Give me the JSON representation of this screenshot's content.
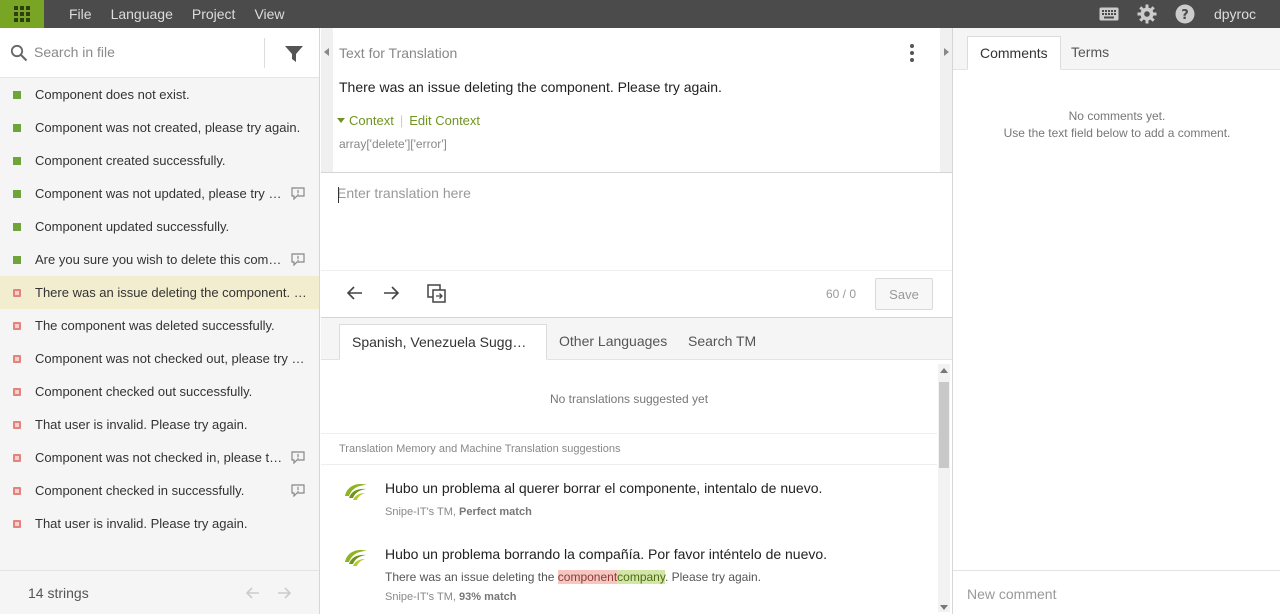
{
  "menu": [
    "File",
    "Language",
    "Project",
    "View"
  ],
  "user": {
    "name": "dpyroc"
  },
  "icons": {
    "apps": "apps-grid-icon",
    "keyboard": "keyboard-icon",
    "settings": "gear-icon",
    "help": "help-icon"
  },
  "colors": {
    "accent": "#78a524",
    "topbar": "#4b4b4b",
    "translated": "#6fa43a",
    "untranslated": "#e4837e",
    "selected_row": "#f3edcf",
    "link": "#6f9520"
  },
  "sidebar": {
    "search_placeholder": "Search in file",
    "strings": [
      {
        "text": "Component does not exist.",
        "status": "translated",
        "comment": false
      },
      {
        "text": "Component was not created, please try again.",
        "status": "translated",
        "comment": false
      },
      {
        "text": "Component created successfully.",
        "status": "translated",
        "comment": false
      },
      {
        "text": "Component was not updated, please try again.",
        "status": "translated",
        "comment": true
      },
      {
        "text": "Component updated successfully.",
        "status": "translated",
        "comment": false
      },
      {
        "text": "Are you sure you wish to delete this component?",
        "status": "translated",
        "comment": true
      },
      {
        "text": "There was an issue deleting the component. Please try again.",
        "status": "untranslated",
        "comment": false,
        "active": true
      },
      {
        "text": "The component was deleted successfully.",
        "status": "untranslated",
        "comment": false
      },
      {
        "text": "Component was not checked out, please try again.",
        "status": "untranslated",
        "comment": false
      },
      {
        "text": "Component checked out successfully.",
        "status": "untranslated",
        "comment": false
      },
      {
        "text": "That user is invalid. Please try again.",
        "status": "untranslated",
        "comment": false
      },
      {
        "text": "Component was not checked in, please try again.",
        "status": "untranslated",
        "comment": true
      },
      {
        "text": "Component checked in successfully.",
        "status": "untranslated",
        "comment": true
      },
      {
        "text": "That user is invalid. Please try again.",
        "status": "untranslated",
        "comment": false
      }
    ],
    "footer": {
      "count": "14 strings"
    }
  },
  "editor": {
    "section_label": "Text for Translation",
    "source_text": "There was an issue deleting the component. Please try again.",
    "context_label": "Context",
    "edit_context_label": "Edit Context",
    "context_value": "array['delete']['error']",
    "translation_placeholder": "Enter translation here",
    "char_count": "60 / 0",
    "save_label": "Save"
  },
  "suggestions": {
    "tabs": [
      "Spanish, Venezuela Suggestions",
      "Other Languages",
      "Search TM"
    ],
    "empty_text": "No translations suggested yet",
    "tm_header": "Translation Memory and Machine Translation suggestions",
    "items": [
      {
        "text": "Hubo un problema al querer borrar el componente, intentalo de nuevo.",
        "source": "Snipe-IT's TM, ",
        "match": "Perfect match"
      },
      {
        "text": "Hubo un problema borrando la compañía. Por favor inténtelo de nuevo.",
        "diff_before": "There was an issue deleting the ",
        "diff_del": "component",
        "diff_ins": "company",
        "diff_after": ". Please try again.",
        "source": "Snipe-IT's TM, ",
        "match": "93% match"
      }
    ]
  },
  "right_panel": {
    "tabs": [
      "Comments",
      "Terms"
    ],
    "empty_line1": "No comments yet.",
    "empty_line2": "Use the text field below to add a comment.",
    "comment_placeholder": "New comment"
  }
}
